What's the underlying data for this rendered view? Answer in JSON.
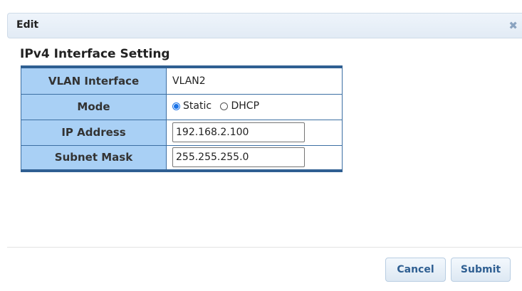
{
  "dialog": {
    "title": "Edit",
    "close_glyph": "✖",
    "close_icon": "close-icon"
  },
  "section": {
    "title": "IPv4 Interface Setting"
  },
  "form": {
    "vlan_interface": {
      "label": "VLAN Interface",
      "value": "VLAN2"
    },
    "mode": {
      "label": "Mode",
      "options": [
        {
          "label": "Static",
          "selected": true
        },
        {
          "label": "DHCP",
          "selected": false
        }
      ]
    },
    "ip_address": {
      "label": "IP Address",
      "value": "192.168.2.100"
    },
    "subnet_mask": {
      "label": "Subnet Mask",
      "value": "255.255.255.0"
    }
  },
  "buttons": {
    "cancel": "Cancel",
    "submit": "Submit"
  },
  "colors": {
    "label_cell_bg": "#a9d0f5",
    "table_border": "#2f5f92",
    "radio_accent": "#1a73e8",
    "button_text": "#2f5f92"
  }
}
